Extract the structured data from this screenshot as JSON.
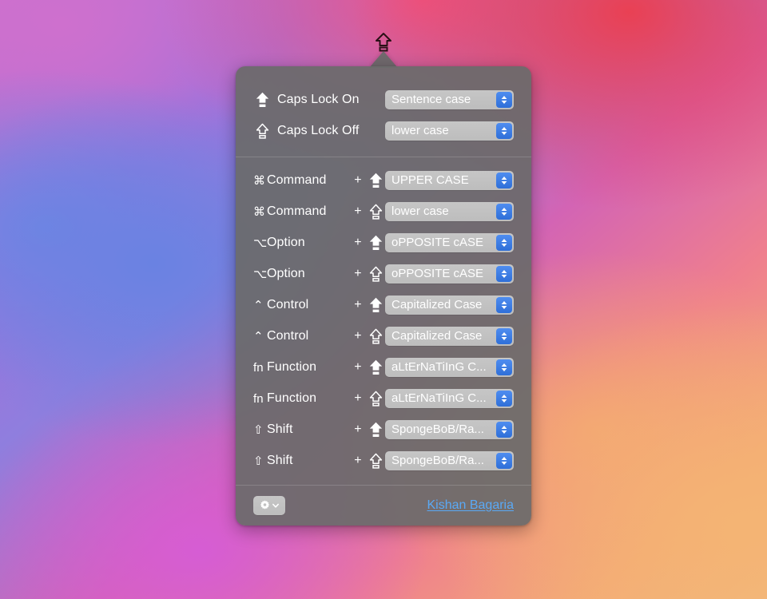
{
  "wallpaper": {
    "colors": [
      "#cb6fcd",
      "#7086e4",
      "#ec3e4e",
      "#f0bc80",
      "#d65cd6"
    ]
  },
  "menubar": {
    "icon": "caps-lock-icon"
  },
  "popover": {
    "background_color": "#6a6a6a",
    "caps_sections": [
      {
        "icon": "caps-lock-arrow-filled-icon",
        "icon_state": "filled",
        "label": "Caps Lock On",
        "value": "Sentence case"
      },
      {
        "icon": "caps-lock-arrow-outline-icon",
        "icon_state": "outline",
        "label": "Caps Lock Off",
        "value": "lower case"
      }
    ],
    "modifier_rows": [
      {
        "symbol": "⌘",
        "symbol_name": "command-symbol",
        "name": "Command",
        "plus": "+",
        "arrow_state": "filled",
        "arrow_icon": "caps-lock-arrow-filled-icon",
        "value": "UPPER CASE"
      },
      {
        "symbol": "⌘",
        "symbol_name": "command-symbol",
        "name": "Command",
        "plus": "+",
        "arrow_state": "outline",
        "arrow_icon": "caps-lock-arrow-outline-icon",
        "value": "lower case"
      },
      {
        "symbol": "⌥",
        "symbol_name": "option-symbol",
        "name": "Option",
        "plus": "+",
        "arrow_state": "filled",
        "arrow_icon": "caps-lock-arrow-filled-icon",
        "value": "oPPOSITE cASE"
      },
      {
        "symbol": "⌥",
        "symbol_name": "option-symbol",
        "name": "Option",
        "plus": "+",
        "arrow_state": "outline",
        "arrow_icon": "caps-lock-arrow-outline-icon",
        "value": "oPPOSITE cASE"
      },
      {
        "symbol": "⌃",
        "symbol_name": "control-symbol",
        "name": "Control",
        "plus": "+",
        "arrow_state": "filled",
        "arrow_icon": "caps-lock-arrow-filled-icon",
        "value": "Capitalized Case"
      },
      {
        "symbol": "⌃",
        "symbol_name": "control-symbol",
        "name": "Control",
        "plus": "+",
        "arrow_state": "outline",
        "arrow_icon": "caps-lock-arrow-outline-icon",
        "value": "Capitalized Case"
      },
      {
        "symbol": "fn",
        "symbol_name": "function-symbol",
        "name": "Function",
        "plus": "+",
        "arrow_state": "filled",
        "arrow_icon": "caps-lock-arrow-filled-icon",
        "value": "aLtErNaTiInG C..."
      },
      {
        "symbol": "fn",
        "symbol_name": "function-symbol",
        "name": "Function",
        "plus": "+",
        "arrow_state": "outline",
        "arrow_icon": "caps-lock-arrow-outline-icon",
        "value": "aLtErNaTiInG C..."
      },
      {
        "symbol": "⇧",
        "symbol_name": "shift-symbol",
        "name": "Shift",
        "plus": "+",
        "arrow_state": "filled",
        "arrow_icon": "caps-lock-arrow-filled-icon",
        "value": "SpongeBoB/Ra..."
      },
      {
        "symbol": "⇧",
        "symbol_name": "shift-symbol",
        "name": "Shift",
        "plus": "+",
        "arrow_state": "outline",
        "arrow_icon": "caps-lock-arrow-outline-icon",
        "value": "SpongeBoB/Ra..."
      }
    ],
    "footer": {
      "settings_button": {
        "icon": "gear-icon",
        "chevron": "chevron-down-icon"
      },
      "credit": "Kishan Bagaria"
    }
  }
}
